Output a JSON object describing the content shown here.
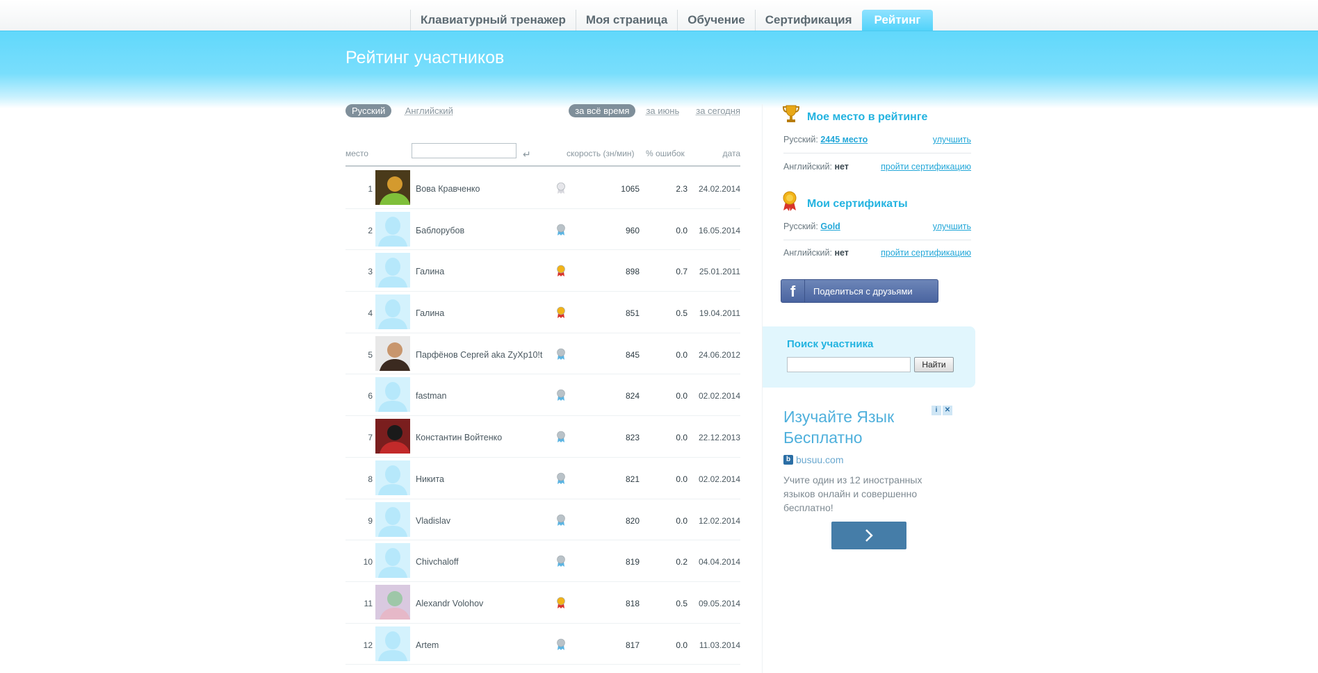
{
  "nav": {
    "items": [
      {
        "label": "Клавиатурный тренажер"
      },
      {
        "label": "Моя страница"
      },
      {
        "label": "Обучение"
      },
      {
        "label": "Сертификация"
      },
      {
        "label": "Рейтинг"
      }
    ],
    "active": "Рейтинг"
  },
  "page_title": "Рейтинг участников",
  "filters": {
    "languages": [
      "Русский",
      "Английский"
    ],
    "selected_language": "Русский",
    "periods": [
      "за всё время",
      "за июнь",
      "за сегодня"
    ],
    "selected_period": "за всё время"
  },
  "table": {
    "headers": {
      "place": "место",
      "speed": "скорость (зн/мин)",
      "errors": "% ошибок",
      "date": "дата"
    },
    "search_placeholder": "",
    "rows": [
      {
        "place": "1",
        "name": "Вова Кравченко",
        "medal": "platinum",
        "speed": "1065",
        "errors": "2.3",
        "date": "24.02.2014",
        "avatar": "photo"
      },
      {
        "place": "2",
        "name": "Баблорубов",
        "medal": "silver",
        "speed": "960",
        "errors": "0.0",
        "date": "16.05.2014",
        "avatar": "default"
      },
      {
        "place": "3",
        "name": "Галина",
        "medal": "gold",
        "speed": "898",
        "errors": "0.7",
        "date": "25.01.2011",
        "avatar": "default"
      },
      {
        "place": "4",
        "name": "Галина",
        "medal": "gold",
        "speed": "851",
        "errors": "0.5",
        "date": "19.04.2011",
        "avatar": "default"
      },
      {
        "place": "5",
        "name": "Парфёнов Сергей aka ZyXp10!t",
        "medal": "silver",
        "speed": "845",
        "errors": "0.0",
        "date": "24.06.2012",
        "avatar": "photo"
      },
      {
        "place": "6",
        "name": "fastman",
        "medal": "silver",
        "speed": "824",
        "errors": "0.0",
        "date": "02.02.2014",
        "avatar": "default"
      },
      {
        "place": "7",
        "name": "Константин Войтенко",
        "medal": "silver",
        "speed": "823",
        "errors": "0.0",
        "date": "22.12.2013",
        "avatar": "photo"
      },
      {
        "place": "8",
        "name": "Никита",
        "medal": "silver",
        "speed": "821",
        "errors": "0.0",
        "date": "02.02.2014",
        "avatar": "default"
      },
      {
        "place": "9",
        "name": "Vladislav",
        "medal": "silver",
        "speed": "820",
        "errors": "0.0",
        "date": "12.02.2014",
        "avatar": "default"
      },
      {
        "place": "10",
        "name": "Chivchaloff",
        "medal": "silver",
        "speed": "819",
        "errors": "0.2",
        "date": "04.04.2014",
        "avatar": "default"
      },
      {
        "place": "11",
        "name": "Alexandr Volohov",
        "medal": "gold",
        "speed": "818",
        "errors": "0.5",
        "date": "09.05.2014",
        "avatar": "photo"
      },
      {
        "place": "12",
        "name": "Artem",
        "medal": "silver",
        "speed": "817",
        "errors": "0.0",
        "date": "11.03.2014",
        "avatar": "default"
      }
    ]
  },
  "sidebar": {
    "my_place": {
      "title": "Мое место в рейтинге",
      "ru_label": "Русский:",
      "ru_value": "2445 место",
      "ru_action": "улучшить",
      "en_label": "Английский:",
      "en_value": "нет",
      "en_action": "пройти сертификацию"
    },
    "certs": {
      "title": "Мои сертификаты",
      "ru_label": "Русский:",
      "ru_value": "Gold",
      "ru_action": "улучшить",
      "en_label": "Английский:",
      "en_value": "нет",
      "en_action": "пройти сертификацию"
    },
    "share_label": "Поделиться с друзьями",
    "search": {
      "title": "Поиск участника",
      "button": "Найти",
      "placeholder": ""
    }
  },
  "ad": {
    "headline": "Изучайте Язык Бесплатно",
    "source": "busuu.com",
    "body": "Учите один из 12 иностранных языков онлайн и совершенно бесплатно!"
  },
  "colors": {
    "accent": "#23b3e0",
    "banner": "#61d8fb",
    "facebook": "#4a64a0"
  }
}
